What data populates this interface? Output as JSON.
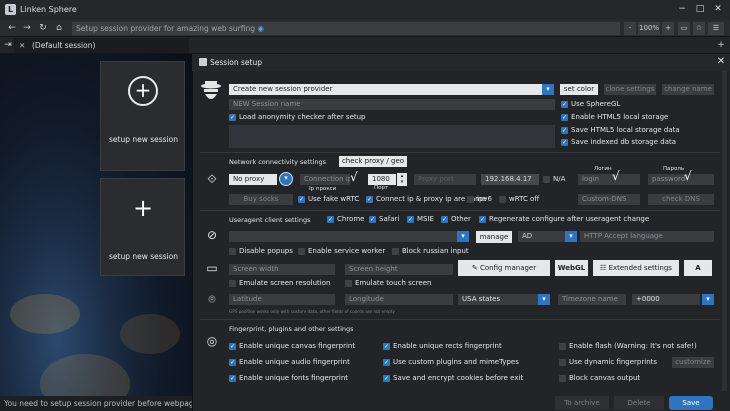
{
  "window": {
    "title": "Linken Sphere",
    "logo": "L",
    "minimize": "−",
    "maximize": "□",
    "close": "✕"
  },
  "nav": {
    "back": "←",
    "forward": "→",
    "reload": "↻",
    "home": "⌂",
    "url": "Setup session provider for amazing web surfing",
    "zoom_minus": "-",
    "zoom": "100%",
    "zoom_plus": "+"
  },
  "tabs": [
    {
      "label": "(Default session)"
    }
  ],
  "tab_new": "+",
  "left": {
    "card1_label": "setup new session",
    "card2_label": "setup new session",
    "status": "You need to setup session provider before webpage"
  },
  "panel": {
    "title": "Session setup",
    "close": "✕",
    "provider_select": "Create new session provider",
    "set_color": "set color",
    "clone_settings": "clone settings",
    "change_name": "change name",
    "session_name_placeholder": "NEW Session name",
    "load_anon": "Load anonymity checker after setup",
    "use_spheregl": "Use SphereGL",
    "enable_html5": "Enable HTML5 local storage",
    "save_html5": "Save HTML5 local storage data",
    "save_indexed": "Save indexed db storage data",
    "network_title": "Network connectivity settings",
    "check_proxy": "check proxy / geo",
    "proxy_type": "No proxy",
    "connection_ip": "Connection ip",
    "ip_proxy_hint": "Ip прокси",
    "port": "1080",
    "port_hint": "Порт",
    "proxy_placeholder": "Proxy port",
    "local_ip": "192.168.4.17",
    "na": "N/A",
    "login_hint": "Логин",
    "login": "login",
    "password_hint": "Пароль",
    "password": "password",
    "buy_socks": "Buy socks",
    "fake_webrtc": "Use fake wRTC",
    "connect_same": "Connect ip & proxy ip are same",
    "ipv6": "ipv6",
    "webrtc_off": "wRTC off",
    "custom_dns": "Custom-DNS",
    "check_dns": "check DNS",
    "ua_title": "Useragent client settings",
    "chrome": "Chrome",
    "safari": "Safari",
    "msie": "MSIE",
    "other": "Other",
    "regen_ua": "Regenerate configure after useragent change",
    "manage": "manage",
    "lang_code": "AD",
    "accept_lang": "HTTP Accept language",
    "disable_popups": "Disable popups",
    "enable_sw": "Enable service worker",
    "block_russian": "Block russian input",
    "screen_width": "Screen width",
    "screen_height": "Screen height",
    "config_manager": "Config manager",
    "webgl": "WebGL",
    "ext_settings": "Extended settings",
    "font_btn": "A",
    "emulate_resolution": "Emulate screen resolution",
    "emulate_touch": "Emulate touch screen",
    "latitude": "Latitude",
    "longitude": "Longitude",
    "geo_state": "USA states",
    "timezone": "Timezone name",
    "tz_offset": "+0000",
    "gps_note": "GPS position works only with custom data, other fields of coords are not empty",
    "fp_title": "Fingerprint, plugins and other settings",
    "fp_canvas": "Enable unique canvas fingerprint",
    "fp_rects": "Enable unique rects fingerprint",
    "fp_flash": "Enable flash (Warning: It's not safe!)",
    "fp_audio": "Enable unique audio fingerprint",
    "fp_plugins": "Use custom plugins and mimeTypes",
    "fp_dynamic": "Use dynamic fingerprints",
    "fp_customize": "customize",
    "fp_fonts": "Enable unique fonts fingerprint",
    "fp_cookies": "Save and encrypt cookies before exit",
    "fp_block_canvas": "Block canvas output",
    "to_archive": "To archive",
    "delete": "Delete",
    "save": "Save"
  },
  "colors": {
    "accent": "#2f74c0",
    "bg": "#1a1b1e",
    "panel": "#232428"
  }
}
